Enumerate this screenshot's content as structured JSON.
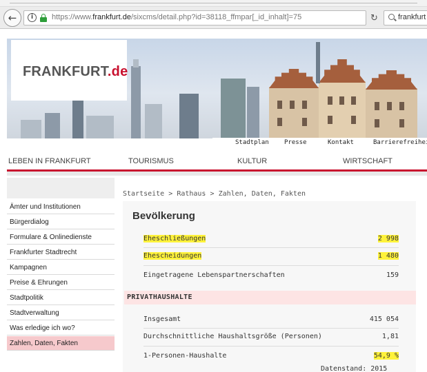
{
  "browser": {
    "url_prefix": "https://www.",
    "url_domain": "frankfurt.de",
    "url_rest": "/sixcms/detail.php?id=38118_ffmpar[_id_inhalt]=75",
    "search_text": "frankfurt ein"
  },
  "header": {
    "logo_main": "FRANKFURT",
    "logo_suffix": ".de",
    "util_links": [
      "Stadtplan",
      "Presse",
      "Kontakt",
      "Barrierefreiheit"
    ]
  },
  "main_nav": [
    "LEBEN IN FRANKFURT",
    "TOURISMUS",
    "KULTUR",
    "WIRTSCHAFT"
  ],
  "breadcrumb": [
    "Startseite",
    "Rathaus",
    "Zahlen, Daten, Fakten"
  ],
  "breadcrumb_separator": ">",
  "sidebar": {
    "items": [
      "Ämter und Institutionen",
      "Bürgerdialog",
      "Formulare & Onlinedienste",
      "Frankfurter Stadtrecht",
      "Kampagnen",
      "Preise & Ehrungen",
      "Stadtpolitik",
      "Stadtverwaltung",
      "Was erledige ich wo?",
      "Zahlen, Daten, Fakten"
    ]
  },
  "content": {
    "title": "Bevölkerung",
    "rows": [
      {
        "label": "Eheschließungen",
        "value": "2 998"
      },
      {
        "label": "Ehescheidungen",
        "value": "1 480"
      },
      {
        "label": "Eingetragene Lebenspartnerschaften",
        "value": "159"
      }
    ],
    "section_title": "PRIVATHAUSHALTE",
    "household_rows": [
      {
        "label": "Insgesamt",
        "value": "415 054"
      },
      {
        "label": "Durchschnittliche Haushaltsgröße (Personen)",
        "value": "1,81"
      },
      {
        "label": "1-Personen-Haushalte",
        "value": "54,9 %"
      }
    ],
    "footnote": "Datenstand: 2015"
  },
  "colors": {
    "accent_red": "#c8102e",
    "highlight_yellow": "#fff23a",
    "section_pink": "#fde4e4",
    "sidebar_active": "#f6c9cc"
  }
}
